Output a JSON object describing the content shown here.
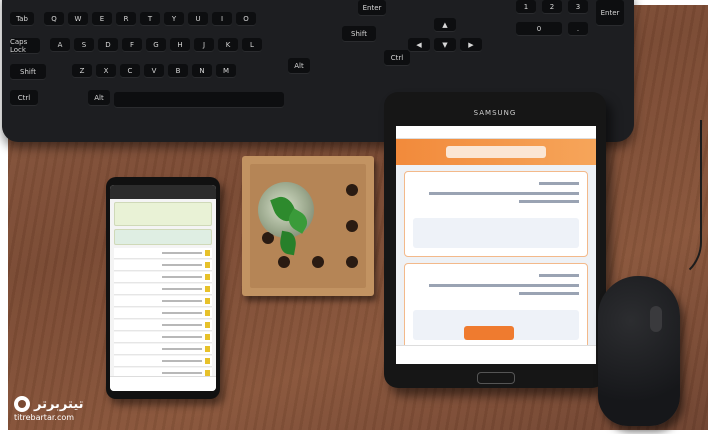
{
  "keyboard": {
    "keys": [
      "Tab",
      "Q",
      "W",
      "E",
      "R",
      "T",
      "Y",
      "U",
      "I",
      "O",
      "Caps Lock",
      "A",
      "S",
      "D",
      "F",
      "G",
      "H",
      "J",
      "K",
      "L",
      "Shift",
      "Z",
      "X",
      "C",
      "V",
      "B",
      "N",
      "M",
      "Ctrl",
      "Alt",
      "Alt",
      "Ctrl",
      "Enter",
      "Shift",
      "Enter"
    ]
  },
  "tablet": {
    "brand": "SAMSUNG"
  },
  "watermark": {
    "brand": "تیتربرتر",
    "url": "titrebartar.com"
  },
  "colors": {
    "desk": "#7a4a33",
    "orange": "#f28a3b",
    "keyboard": "#1d1e21"
  }
}
